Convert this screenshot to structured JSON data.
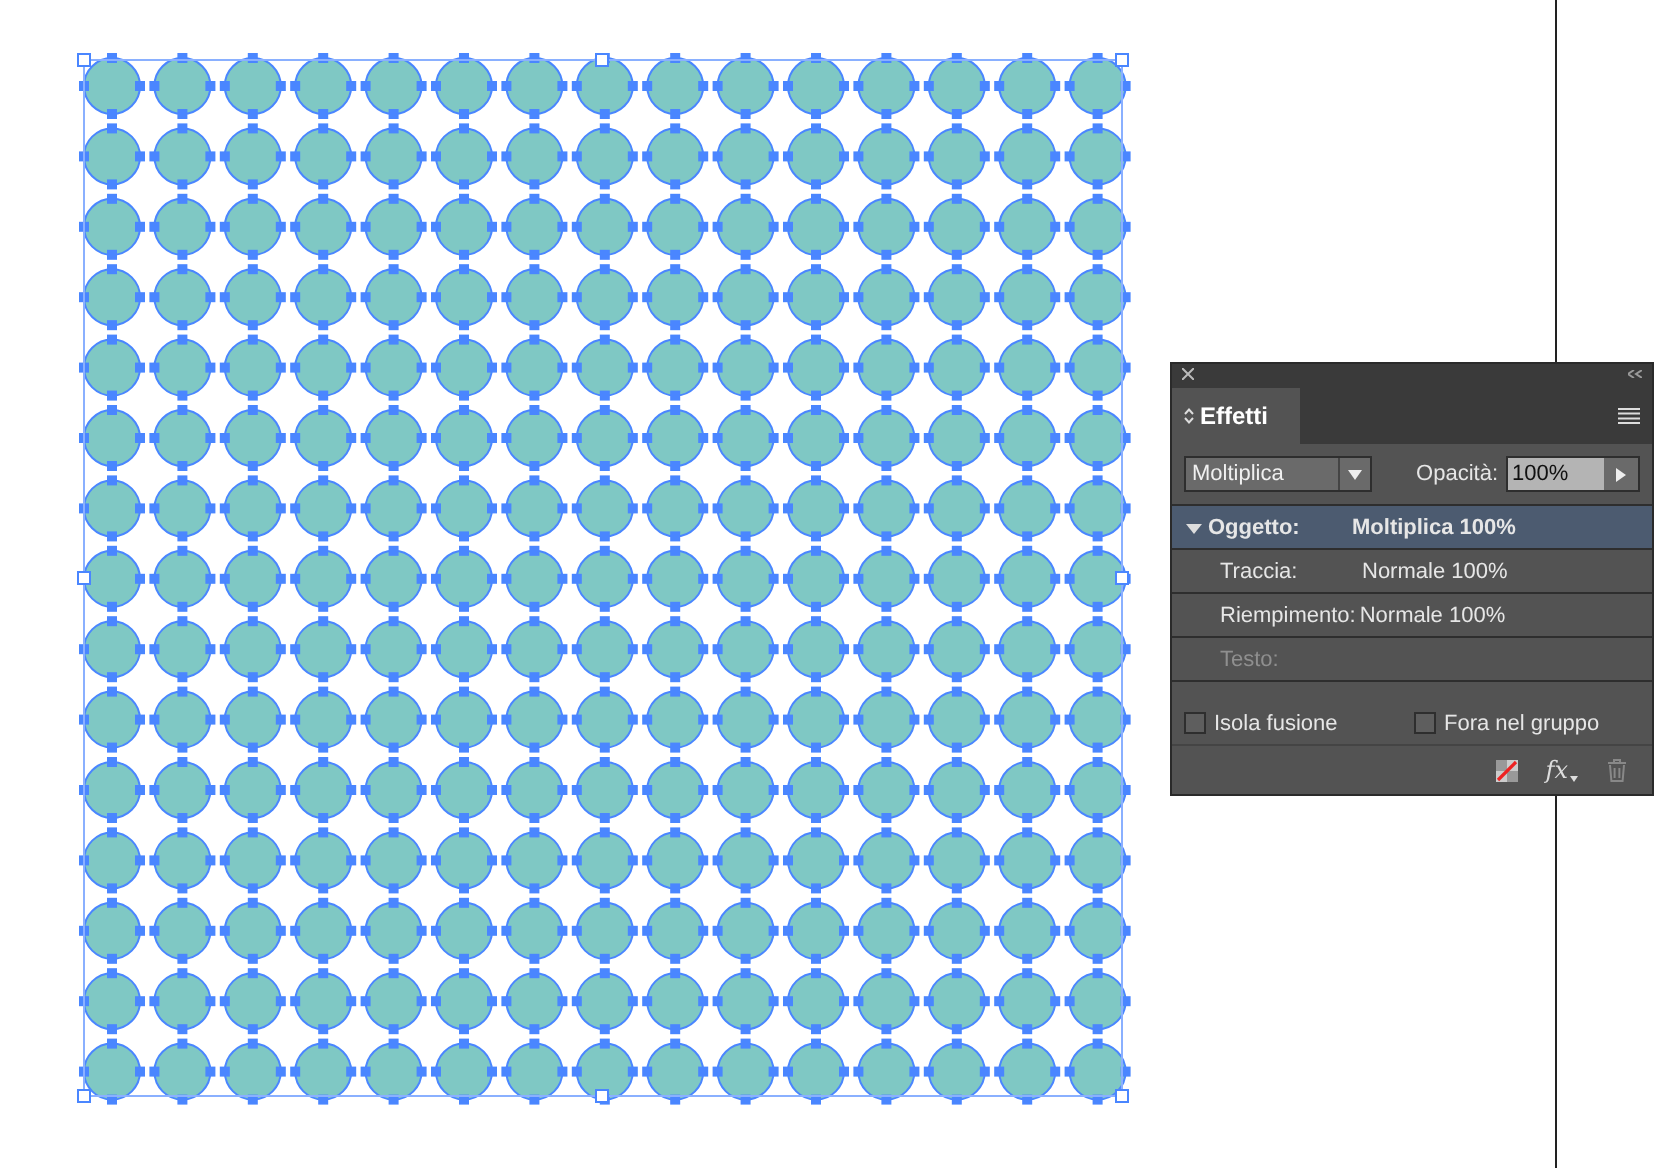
{
  "panel": {
    "title": "Effetti",
    "blend_mode": "Moltiplica",
    "opacity_label": "Opacità:",
    "opacity_value": "100%",
    "targets": [
      {
        "label": "Oggetto:",
        "value": "Moltiplica 100%",
        "selected": true,
        "expanded": true,
        "disabled": false,
        "kind": "parent"
      },
      {
        "label": "Traccia:",
        "value": "Normale 100%",
        "selected": false,
        "disabled": false,
        "kind": "child"
      },
      {
        "label": "Riempimento:",
        "value": "Normale 100%",
        "selected": false,
        "disabled": false,
        "kind": "child"
      },
      {
        "label": "Testo:",
        "selected": false,
        "disabled": true,
        "kind": "child"
      }
    ],
    "options": [
      {
        "label": "Isola fusione",
        "checked": false
      },
      {
        "label": "Fora nel gruppo",
        "checked": false
      }
    ],
    "fx_label": "fx"
  }
}
